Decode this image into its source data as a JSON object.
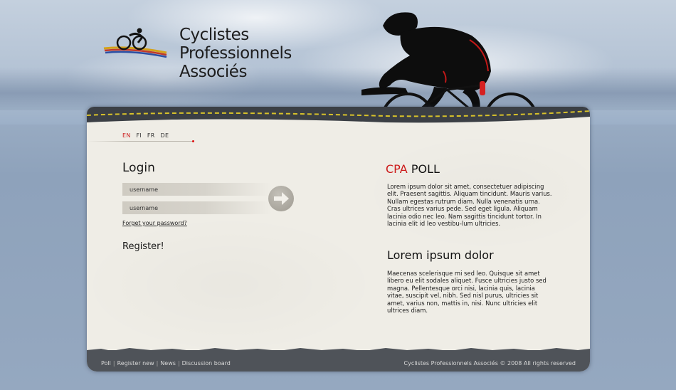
{
  "header": {
    "brand_lines": [
      "Cyclistes",
      "Professionnels",
      "Associés"
    ]
  },
  "languages": [
    {
      "code": "EN",
      "active": true
    },
    {
      "code": "FI",
      "active": false
    },
    {
      "code": "FR",
      "active": false
    },
    {
      "code": "DE",
      "active": false
    }
  ],
  "login": {
    "title": "Login",
    "username_placeholder": "username",
    "password_placeholder": "username",
    "forgot_label": "Forget your password?",
    "register_label": "Register!"
  },
  "poll": {
    "title_accent": "CPA",
    "title_rest": "POLL",
    "text": "Lorem ipsum dolor sit amet, consectetuer adipiscing elit. Praesent sagittis. Aliquam tincidunt. Mauris varius. Nullam egestas rutrum diam. Nulla venenatis urna. Cras ultrices varius pede. Sed eget ligula. Aliquam lacinia odio nec leo. Nam sagittis tincidunt tortor. In lacinia elit id leo vestibu-lum ultricies."
  },
  "lorem": {
    "title": "Lorem ipsum dolor",
    "text": "Maecenas scelerisque mi sed leo. Quisque sit amet libero eu elit sodales aliquet. Fusce ultricies justo sed magna. Pellentesque orci nisi, lacinia quis, lacinia vitae, suscipit vel, nibh. Sed nisl purus, ultricies sit amet, varius non, mattis in, nisi. Nunc ultricies elit ultrices diam."
  },
  "footer": {
    "links": [
      "Poll",
      "Register new",
      "News",
      "Discussion board"
    ],
    "copyright": "Cyclistes Professionnels Associés  © 2008 All rights reserved"
  },
  "colors": {
    "accent": "#cc1a1a",
    "panel": "#efede6",
    "footer": "#4f5359"
  }
}
